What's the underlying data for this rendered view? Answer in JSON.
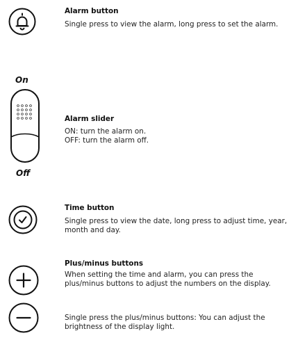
{
  "alarm_button": {
    "icon": "bell-icon",
    "title": "Alarm button",
    "description": "Single press to view the alarm, long press to set the alarm."
  },
  "alarm_slider": {
    "icon": "slider-switch-icon",
    "label_on": "On",
    "label_off": "Off",
    "title": "Alarm slider",
    "line1": "ON: turn the alarm on.",
    "line2": "OFF: turn the alarm off."
  },
  "time_button": {
    "icon": "clock-icon",
    "title": "Time button",
    "description": "Single press to view the date, long press to adjust time, year, month and day."
  },
  "plus_minus": {
    "icons": [
      "plus-icon",
      "minus-icon"
    ],
    "title": "Plus/minus buttons",
    "description1": "When setting the time and alarm, you can press the plus/minus buttons to adjust the numbers on the display.",
    "description2": "Single press the plus/minus buttons: You can adjust the brightness of the display light."
  }
}
